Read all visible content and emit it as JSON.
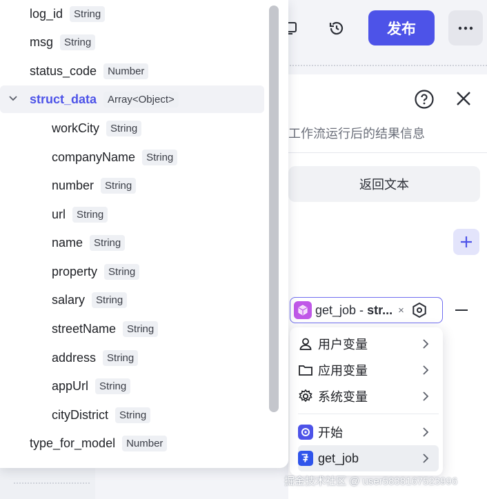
{
  "toolbar": {
    "publish_label": "发布",
    "history_icon": "history-icon",
    "debug_icon": "debug-icon",
    "more_icon": "more-icon"
  },
  "panel": {
    "description": "工作流运行后的结果信息",
    "return_text_label": "返回文本"
  },
  "variable_ref": {
    "label_prefix": "get_job - ",
    "label_bold": "str...",
    "clear_symbol": "×"
  },
  "dropdown": {
    "items": [
      {
        "label": "用户变量",
        "icon": "user-icon"
      },
      {
        "label": "应用变量",
        "icon": "folder-icon"
      },
      {
        "label": "系统变量",
        "icon": "gear-icon"
      },
      {
        "label": "开始",
        "icon": "start-node-icon"
      },
      {
        "label": "get_job",
        "icon": "job-plugin-icon"
      }
    ]
  },
  "tree": {
    "items": [
      {
        "name": "log_id",
        "type": "String",
        "level": 0
      },
      {
        "name": "msg",
        "type": "String",
        "level": 0
      },
      {
        "name": "status_code",
        "type": "Number",
        "level": 0
      },
      {
        "name": "struct_data",
        "type": "Array<Object>",
        "level": 0,
        "expanded": true,
        "selected": true
      },
      {
        "name": "workCity",
        "type": "String",
        "level": 1
      },
      {
        "name": "companyName",
        "type": "String",
        "level": 1
      },
      {
        "name": "number",
        "type": "String",
        "level": 1
      },
      {
        "name": "url",
        "type": "String",
        "level": 1
      },
      {
        "name": "name",
        "type": "String",
        "level": 1
      },
      {
        "name": "property",
        "type": "String",
        "level": 1
      },
      {
        "name": "salary",
        "type": "String",
        "level": 1
      },
      {
        "name": "streetName",
        "type": "String",
        "level": 1
      },
      {
        "name": "address",
        "type": "String",
        "level": 1
      },
      {
        "name": "appUrl",
        "type": "String",
        "level": 1
      },
      {
        "name": "cityDistrict",
        "type": "String",
        "level": 1
      },
      {
        "name": "type_for_model",
        "type": "Number",
        "level": 0
      }
    ]
  },
  "watermark": "掘金技术社区 @ user5838167523996",
  "colors": {
    "accent": "#4d53e8",
    "plugin_purple": "#c058e8"
  }
}
